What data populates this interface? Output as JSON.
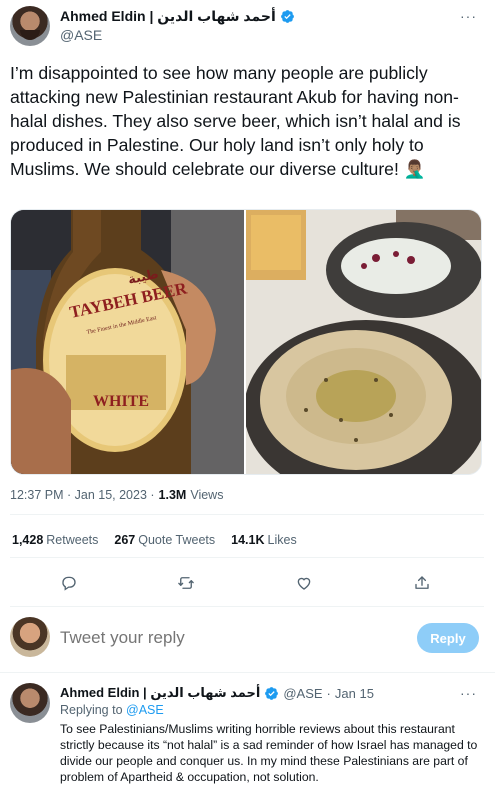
{
  "tweet": {
    "author_name": "Ahmed Eldin | أحمد شهاب الدين",
    "handle": "@ASE",
    "more_label": "···",
    "text": "I’m disappointed to see how many people are publicly attacking new Palestinian restaurant Akub for having non-halal dishes. They also serve beer, which isn’t halal and is produced in Palestine. Our holy land isn’t only holy to Muslims. We should celebrate our diverse culture! 🤦🏽‍♂️",
    "timestamp": "12:37 PM · Jan 15, 2023 ·",
    "views_count": "1.3M",
    "views_label": "Views",
    "photos": {
      "beer_brand": "TAYBEH BEER",
      "beer_variant": "WHITE",
      "beer_tagline": "The Finest in the Middle East",
      "beer_arabic": "طيبة"
    },
    "stats": [
      {
        "count": "1,428",
        "label": "Retweets"
      },
      {
        "count": "267",
        "label": "Quote Tweets"
      },
      {
        "count": "14.1K",
        "label": "Likes"
      }
    ],
    "actions": {
      "reply_icon": "reply-icon",
      "retweet_icon": "retweet-icon",
      "like_icon": "heart-icon",
      "share_icon": "share-icon"
    }
  },
  "reply_box": {
    "placeholder": "Tweet your reply",
    "button_label": "Reply"
  },
  "reply": {
    "author_name": "Ahmed Eldin | أحمد شهاب الدين",
    "handle": "@ASE",
    "separator": "·",
    "date": "Jan 15",
    "replying_prefix": "Replying to",
    "replying_handle": "@ASE",
    "more_label": "···",
    "text": "To see Palestinians/Muslims writing horrible reviews about this restaurant strictly because its “not halal” is a sad reminder of how Israel has managed to divide our people and conquer us. In my mind these Palestinians are part of problem of Apartheid & occupation, not solution."
  },
  "colors": {
    "accent": "#1d9bf0",
    "reply_button_disabled": "#8ecdf8",
    "secondary_text": "#536471"
  }
}
